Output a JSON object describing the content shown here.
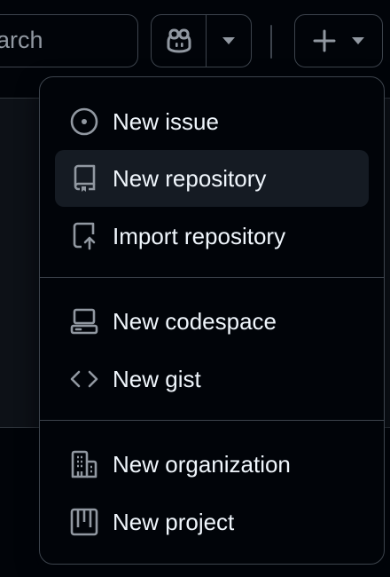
{
  "header": {
    "search_text": "earch",
    "icons": [
      "copilot-icon",
      "triangle-down-icon",
      "plus-icon",
      "triangle-down-icon"
    ]
  },
  "menu": {
    "groups": [
      [
        {
          "label": "New issue",
          "icon": "issue-opened-icon"
        },
        {
          "label": "New repository",
          "icon": "repo-icon",
          "highlighted": true
        },
        {
          "label": "Import repository",
          "icon": "repo-push-icon"
        }
      ],
      [
        {
          "label": "New codespace",
          "icon": "codespaces-icon"
        },
        {
          "label": "New gist",
          "icon": "code-icon"
        }
      ],
      [
        {
          "label": "New organization",
          "icon": "organization-icon"
        },
        {
          "label": "New project",
          "icon": "table-icon"
        }
      ]
    ]
  },
  "colors": {
    "background": "#010409",
    "panel": "#0d1117",
    "border": "#3d444d",
    "text": "#f0f6fc",
    "muted": "#9198a1",
    "hover": "#151b23"
  }
}
